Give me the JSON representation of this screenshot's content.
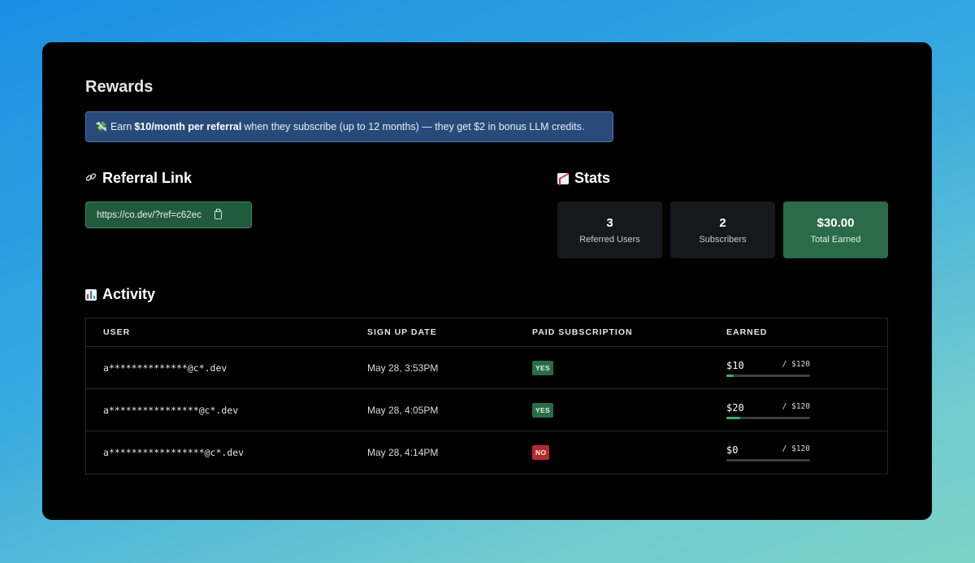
{
  "page": {
    "title": "Rewards"
  },
  "banner": {
    "emoji": "💸",
    "prefix": "Earn",
    "highlight": "$10/month per referral",
    "suffix": "when they subscribe (up to 12 months) — they get $2 in bonus LLM credits."
  },
  "referral": {
    "title": "Referral Link",
    "icon": "link-icon",
    "url": "https://co.dev/?ref=c62ec"
  },
  "stats": {
    "title": "Stats",
    "icon": "chart-increasing-icon",
    "items": [
      {
        "value": "3",
        "label": "Referred Users"
      },
      {
        "value": "2",
        "label": "Subscribers"
      },
      {
        "value": "$30.00",
        "label": "Total Earned"
      }
    ]
  },
  "activity": {
    "title": "Activity",
    "icon": "bar-chart-icon",
    "columns": [
      "USER",
      "SIGN UP DATE",
      "PAID SUBSCRIPTION",
      "EARNED"
    ],
    "rows": [
      {
        "user": "a**************@c*.dev",
        "date": "May 28, 3:53PM",
        "paid": "YES",
        "earned": "$10",
        "cap": "/ $120",
        "progress": 0.083
      },
      {
        "user": "a****************@c*.dev",
        "date": "May 28, 4:05PM",
        "paid": "YES",
        "earned": "$20",
        "cap": "/ $120",
        "progress": 0.167
      },
      {
        "user": "a*****************@c*.dev",
        "date": "May 28, 4:14PM",
        "paid": "NO",
        "earned": "$0",
        "cap": "/ $120",
        "progress": 0
      }
    ]
  },
  "colors": {
    "accent_green": "#2a6b48",
    "banner_blue": "#284a7a",
    "danger": "#b42a2f"
  }
}
